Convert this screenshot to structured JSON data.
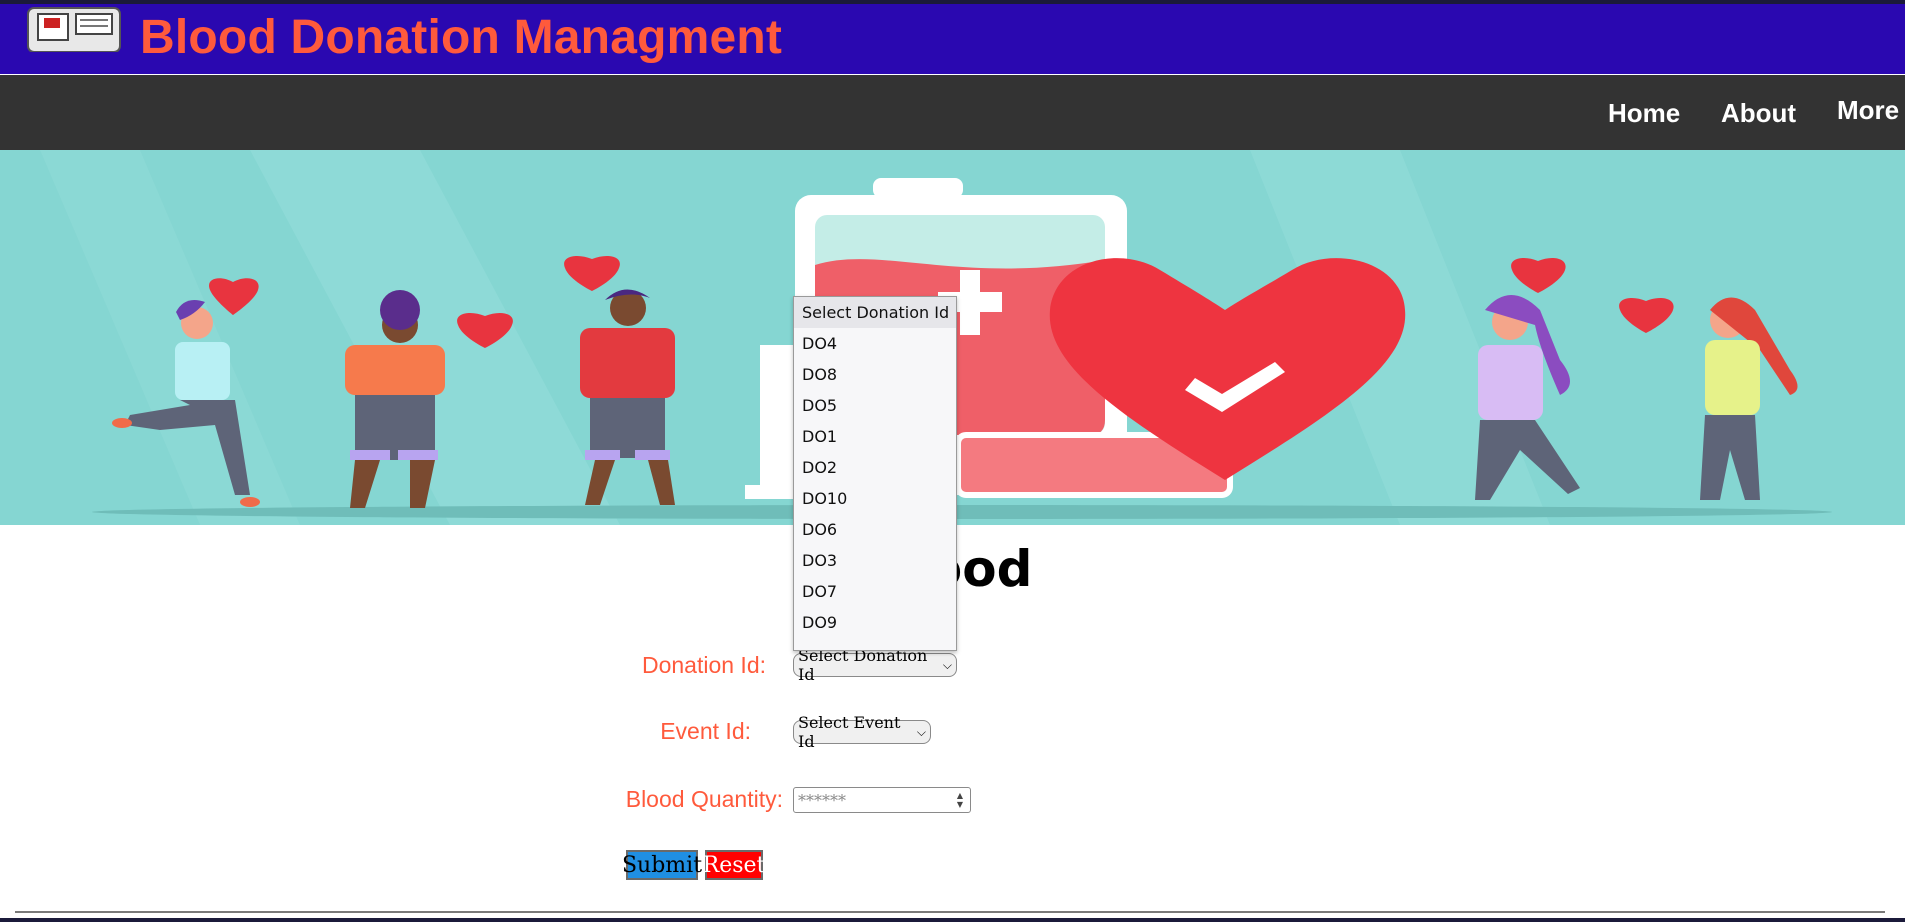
{
  "header": {
    "title": "Blood Donation Managment",
    "logo_icon": "logo-icon"
  },
  "nav": {
    "items": [
      {
        "label": "Home"
      },
      {
        "label": "About"
      },
      {
        "label": "More"
      }
    ]
  },
  "hero": {
    "illustration": "blood-donation-illustration"
  },
  "page": {
    "title_visible": "Blood"
  },
  "form": {
    "donation_label": "Donation Id:",
    "donation_value": "Select Donation Id",
    "event_label": "Event Id:",
    "event_value": "Select Event Id",
    "quantity_label": "Blood Quantity:",
    "quantity_placeholder": "******",
    "submit_label": "Submit",
    "reset_label": "Reset"
  },
  "dropdown": {
    "options": [
      "Select Donation Id",
      "DO4",
      "DO8",
      "DO5",
      "DO1",
      "DO2",
      "DO10",
      "DO6",
      "DO3",
      "DO7",
      "DO9"
    ]
  },
  "colors": {
    "header_bg": "#2a08b0",
    "brand_text": "#ff5a3c",
    "navbar_bg": "#333333",
    "hero_bg": "#85d6d2",
    "submit_bg": "#1f8fe3",
    "reset_bg": "#ff0000"
  }
}
